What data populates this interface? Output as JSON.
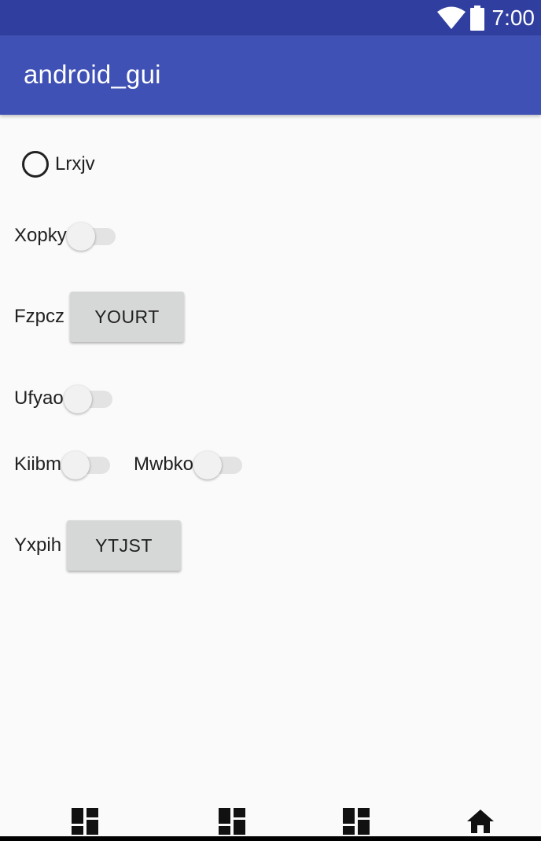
{
  "status_bar": {
    "time": "7:00",
    "icons": [
      "wifi-icon",
      "battery-icon"
    ]
  },
  "app_bar": {
    "title": "android_gui"
  },
  "content": {
    "radio": {
      "label": "Lrxjv",
      "checked": false
    },
    "switch_1": {
      "label": "Xopky",
      "on": false
    },
    "button_row_1": {
      "label": "Fzpcz",
      "button": "YOURT"
    },
    "switch_2": {
      "label": "Ufyao",
      "on": false
    },
    "switch_3": {
      "label": "Kiibm",
      "on": false
    },
    "switch_4": {
      "label": "Mwbko",
      "on": false
    },
    "button_row_2": {
      "label": "Yxpih",
      "button": "YTJST"
    }
  },
  "nav_bar": {
    "icons": [
      "dashboard-icon",
      "dashboard-icon",
      "dashboard-icon",
      "home-icon"
    ]
  },
  "colors": {
    "status_bar": "#303f9f",
    "app_bar": "#3f51b5",
    "background": "#fafafa",
    "button": "#d6d7d7"
  }
}
